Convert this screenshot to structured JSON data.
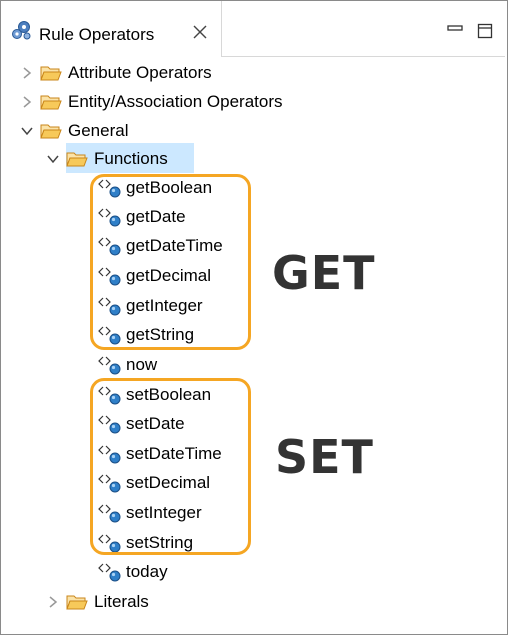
{
  "view": {
    "title": "Rule Operators"
  },
  "tree": {
    "attribute_operators": "Attribute Operators",
    "entity_association_operators": "Entity/Association Operators",
    "general": "General",
    "functions": "Functions",
    "get_functions": [
      "getBoolean",
      "getDate",
      "getDateTime",
      "getDecimal",
      "getInteger",
      "getString"
    ],
    "now": "now",
    "set_functions": [
      "setBoolean",
      "setDate",
      "setDateTime",
      "setDecimal",
      "setInteger",
      "setString"
    ],
    "today": "today",
    "literals": "Literals"
  },
  "annotations": {
    "get_label": "GET",
    "set_label": "SET",
    "highlight_color": "#f5a623"
  },
  "colors": {
    "selection": "#cce8ff",
    "folder": "#e8a93a",
    "function_icon": "#2f7fc8"
  }
}
